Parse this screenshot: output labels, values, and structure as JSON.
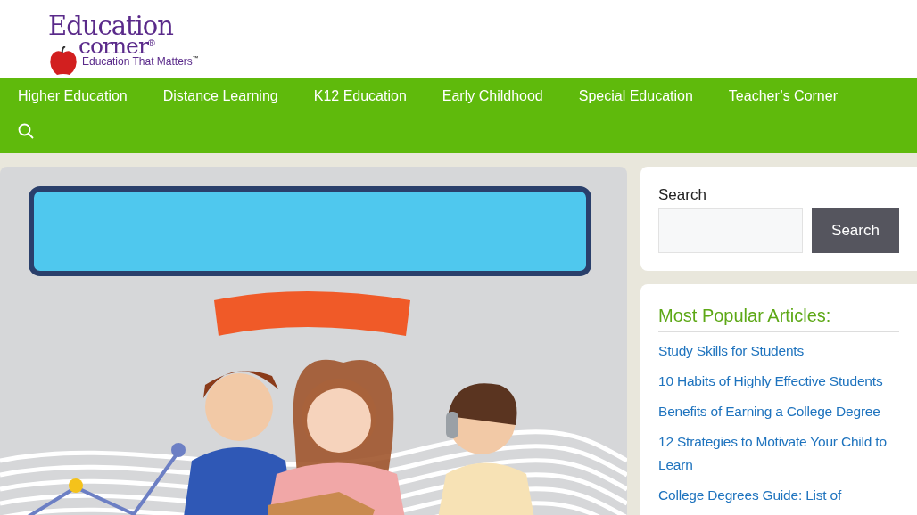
{
  "logo": {
    "line_1": "Education",
    "line_2": "corner",
    "mark": "®",
    "tagline": "Education That Matters",
    "tagline_mark": "™"
  },
  "nav": {
    "items": [
      {
        "label": "Higher Education"
      },
      {
        "label": "Distance Learning"
      },
      {
        "label": "K12 Education"
      },
      {
        "label": "Early Childhood"
      },
      {
        "label": "Special Education"
      },
      {
        "label": "Teacher’s Corner"
      }
    ]
  },
  "search_widget": {
    "label": "Search",
    "button": "Search"
  },
  "popular": {
    "title": "Most Popular Articles:",
    "links": [
      {
        "text": "Study Skills for Students"
      },
      {
        "text": "10 Habits of Highly Effective Students"
      },
      {
        "text": "Benefits of Earning a College Degree"
      },
      {
        "text": "12 Strategies to Motivate Your Child to Learn"
      },
      {
        "text": "College Degrees Guide: List of"
      }
    ]
  }
}
